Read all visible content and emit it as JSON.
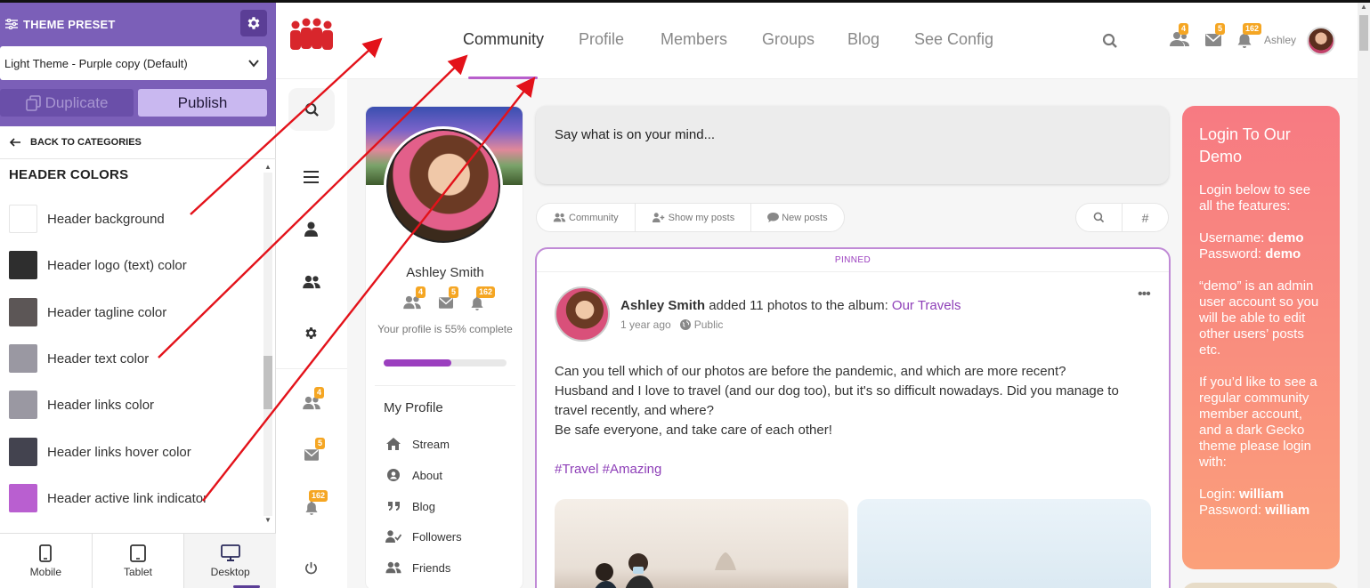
{
  "panel": {
    "title": "THEME PRESET",
    "preset_value": "Light Theme - Purple copy (Default)",
    "duplicate_label": "Duplicate",
    "publish_label": "Publish",
    "back_label": "BACK TO CATEGORIES",
    "section_title": "HEADER COLORS",
    "colors": [
      {
        "label": "Header background",
        "value": "#ffffff"
      },
      {
        "label": "Header logo (text) color",
        "value": "#2e2e2e"
      },
      {
        "label": "Header tagline color",
        "value": "#5c5656"
      },
      {
        "label": "Header text color",
        "value": "#9a98a2"
      },
      {
        "label": "Header links color",
        "value": "#9a98a2"
      },
      {
        "label": "Header links hover color",
        "value": "#43434f"
      },
      {
        "label": "Header active link indicator",
        "value": "#b95fd0"
      }
    ],
    "devices": [
      {
        "label": "Mobile"
      },
      {
        "label": "Tablet"
      },
      {
        "label": "Desktop"
      }
    ]
  },
  "header": {
    "nav": [
      "Community",
      "Profile",
      "Members",
      "Groups",
      "Blog",
      "See Config"
    ],
    "badges": {
      "friends": "4",
      "messages": "5",
      "notifications": "162"
    },
    "username": "Ashley"
  },
  "sidebar": {
    "badges": {
      "friends": "4",
      "messages": "5",
      "notifications": "162"
    }
  },
  "profile_card": {
    "name": "Ashley Smith",
    "badges": {
      "friends": "4",
      "messages": "5",
      "notifications": "162"
    },
    "progress_note": "Your profile is 55% complete",
    "progress": 0.55,
    "section": "My Profile",
    "links": [
      "Stream",
      "About",
      "Blog",
      "Followers",
      "Friends"
    ]
  },
  "feed": {
    "composer_placeholder": "Say what is on your mind...",
    "tabs": [
      "Community",
      "Show my posts",
      "New posts"
    ],
    "hash": "#"
  },
  "post": {
    "pinned": "PINNED",
    "author": "Ashley Smith",
    "action": "added 11 photos to the album:",
    "album": "Our Travels",
    "time": "1 year ago",
    "visibility": "Public",
    "body": [
      "Can you tell which of our photos are before the pandemic, and which are more recent?",
      "Husband and I love to travel (and our dog too), but it's so difficult nowadays. Did you manage to travel recently, and where?",
      "Be safe everyone, and take care of each other!"
    ],
    "tags": "#Travel #Amazing"
  },
  "login_card": {
    "title": "Login To Our Demo",
    "intro": "Login below to see all the features:",
    "username_label": "Username:",
    "username": "demo",
    "password_label": "Password:",
    "password": "demo",
    "admin_note": "“demo” is an admin user account so you will be able to edit other users’ posts etc.",
    "regular_note": "If you’d like to see a regular community member account, and a dark Gecko theme please login with:",
    "login_label": "Login:",
    "login": "william",
    "password2": "william"
  },
  "colors": {
    "panel_header": "#7b5fb8",
    "accent_purple": "#9b3fbf",
    "indicator": "#b85fcc",
    "badge": "#f5a623",
    "arrow": "#e3121a"
  }
}
